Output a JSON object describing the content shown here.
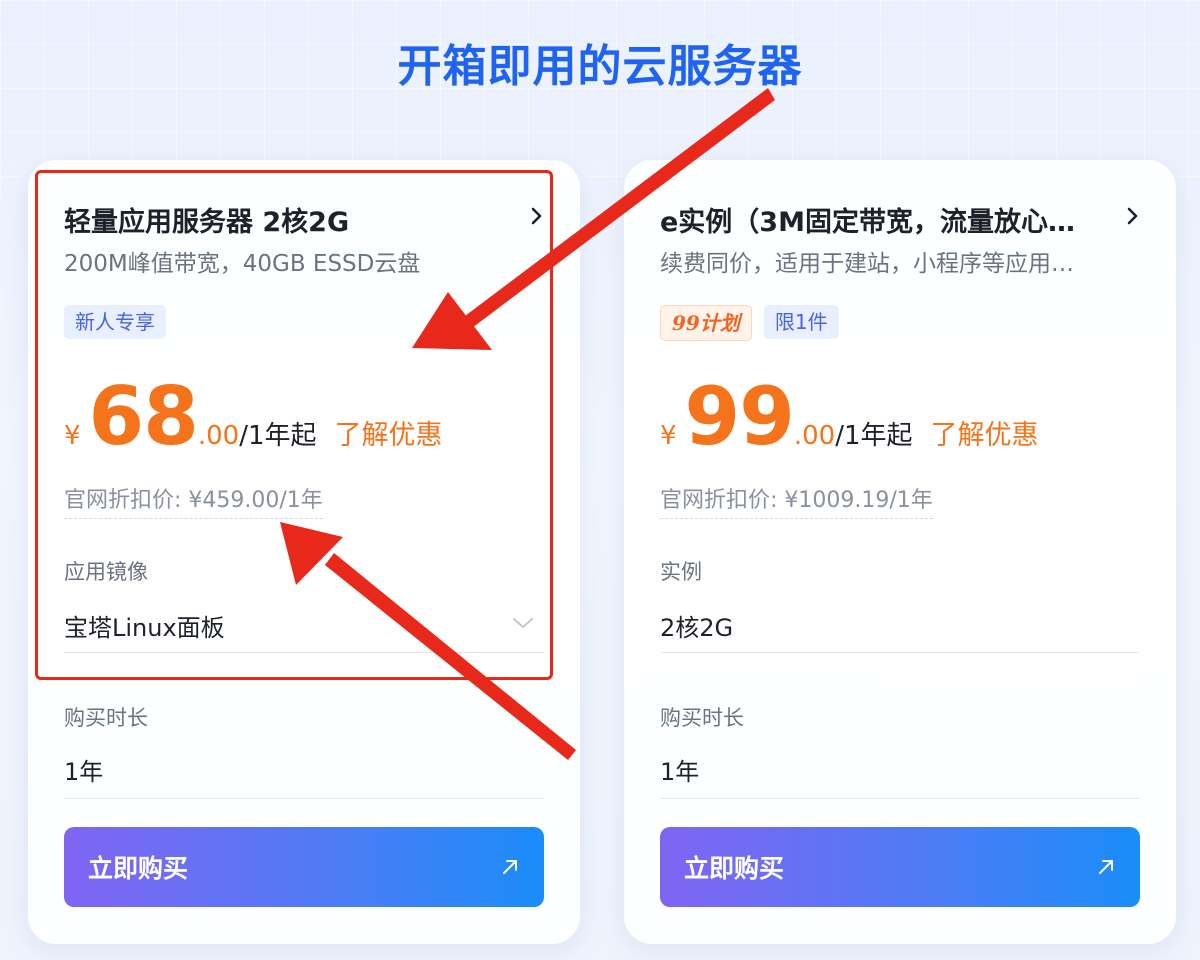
{
  "page": {
    "title": "开箱即用的云服务器"
  },
  "cards": [
    {
      "title": "轻量应用服务器 2核2G",
      "subtitle": "200M峰值带宽，40GB ESSD云盘",
      "badges": [
        "新人专享"
      ],
      "price": {
        "currency": "¥",
        "integer": "68",
        "decimal": ".00",
        "unit": "/1年起",
        "promo_link": "了解优惠"
      },
      "original_price": "官网折扣价: ¥459.00/1年",
      "fields": [
        {
          "label": "应用镜像",
          "value": "宝塔Linux面板",
          "dropdown": true
        },
        {
          "label": "购买时长",
          "value": "1年"
        }
      ],
      "buy_label": "立即购买"
    },
    {
      "title": "e实例（3M固定带宽，流量放心…",
      "subtitle": "续费同价，适用于建站，小程序等应用…",
      "badges": [
        "99计划",
        "限1件"
      ],
      "price": {
        "currency": "¥",
        "integer": "99",
        "decimal": ".00",
        "unit": "/1年起",
        "promo_link": "了解优惠"
      },
      "original_price": "官网折扣价: ¥1009.19/1年",
      "fields": [
        {
          "label": "实例",
          "value": "2核2G"
        },
        {
          "label": "购买时长",
          "value": "1年"
        }
      ],
      "buy_label": "立即购买"
    }
  ],
  "colors": {
    "title_blue": "#1f63f2",
    "price_orange": "#f5731a",
    "annotation_red": "#e8281a",
    "button_gradient": [
      "#8065f3",
      "#1a8df8"
    ]
  },
  "icons": {
    "card_header": "chevron-right-icon",
    "dropdown": "chevron-down-icon",
    "buy_button": "arrow-up-right-icon"
  }
}
